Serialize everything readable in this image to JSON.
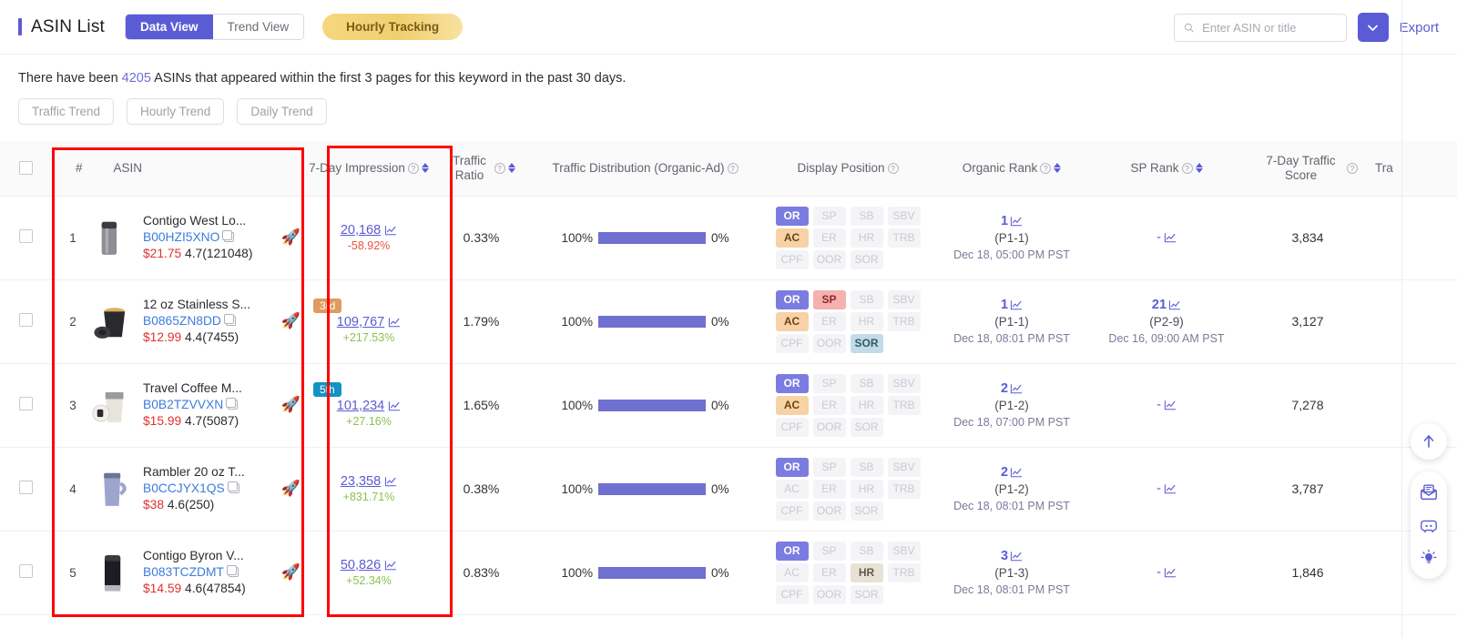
{
  "header": {
    "title": "ASIN List",
    "views": [
      {
        "label": "Data View",
        "active": true
      },
      {
        "label": "Trend View",
        "active": false
      }
    ],
    "hourly_tracking_label": "Hourly Tracking",
    "search": {
      "placeholder": "Enter ASIN or title",
      "value": ""
    },
    "dropdown_icon": "chevron-down-icon",
    "export_label": "Export"
  },
  "info": {
    "prefix": "There have been ",
    "count": "4205",
    "suffix": " ASINs that appeared within the first 3 pages for this keyword in the past 30 days."
  },
  "trend_buttons": [
    {
      "label": "Traffic Trend"
    },
    {
      "label": "Hourly Trend"
    },
    {
      "label": "Daily Trend"
    }
  ],
  "table": {
    "columns": [
      {
        "key": "checkbox",
        "label": ""
      },
      {
        "key": "asin",
        "label": "ASIN",
        "num_label": "#"
      },
      {
        "key": "impression",
        "label": "7-Day Impression",
        "help": true,
        "sortable": true
      },
      {
        "key": "traffic_ratio",
        "label": "Traffic Ratio",
        "help": true,
        "sortable": true
      },
      {
        "key": "traffic_distribution",
        "label": "Traffic Distribution (Organic-Ad)",
        "help": true,
        "sortable": false
      },
      {
        "key": "display_position",
        "label": "Display Position",
        "help": true,
        "sortable": false
      },
      {
        "key": "organic_rank",
        "label": "Organic Rank",
        "help": true,
        "sortable": true
      },
      {
        "key": "sp_rank",
        "label": "SP Rank",
        "help": true,
        "sortable": true
      },
      {
        "key": "traffic_score",
        "label": "7-Day Traffic Score",
        "help": true,
        "sortable": false
      },
      {
        "key": "truncated",
        "label": "Tra"
      }
    ],
    "position_labels": [
      "OR",
      "SP",
      "SB",
      "SBV",
      "AC",
      "ER",
      "HR",
      "TRB",
      "CPF",
      "OOR",
      "SOR"
    ],
    "rows": [
      {
        "num": "1",
        "title": "Contigo West Lo...",
        "asin": "B00HZI5XNO",
        "price": "$21.75",
        "rating": "4.7(121048)",
        "badge": null,
        "badge_color": null,
        "impression": "20,168",
        "delta": "-58.92%",
        "delta_dir": "down",
        "traffic_ratio": "0.33%",
        "dist_organic": "100%",
        "dist_ad": "0%",
        "positions_on": [
          "OR",
          "AC"
        ],
        "organic_rank": "1",
        "organic_page": "(P1-1)",
        "organic_date": "Dec 18, 05:00 PM PST",
        "sp_rank": "-",
        "sp_page": "",
        "sp_date": "",
        "traffic_score": "3,834"
      },
      {
        "num": "2",
        "title": "12 oz Stainless S...",
        "asin": "B0865ZN8DD",
        "price": "$12.99",
        "rating": "4.4(7455)",
        "badge": "3rd",
        "badge_color": "#e09a5f",
        "impression": "109,767",
        "delta": "+217.53%",
        "delta_dir": "up",
        "traffic_ratio": "1.79%",
        "dist_organic": "100%",
        "dist_ad": "0%",
        "positions_on": [
          "OR",
          "SP",
          "AC",
          "SOR"
        ],
        "organic_rank": "1",
        "organic_page": "(P1-1)",
        "organic_date": "Dec 18, 08:01 PM PST",
        "sp_rank": "21",
        "sp_page": "(P2-9)",
        "sp_date": "Dec 16, 09:00 AM PST",
        "traffic_score": "3,127"
      },
      {
        "num": "3",
        "title": "Travel Coffee M...",
        "asin": "B0B2TZVVXN",
        "price": "$15.99",
        "rating": "4.7(5087)",
        "badge": "5th",
        "badge_color": "#1392c4",
        "impression": "101,234",
        "delta": "+27.16%",
        "delta_dir": "up",
        "traffic_ratio": "1.65%",
        "dist_organic": "100%",
        "dist_ad": "0%",
        "positions_on": [
          "OR",
          "AC"
        ],
        "organic_rank": "2",
        "organic_page": "(P1-2)",
        "organic_date": "Dec 18, 07:00 PM PST",
        "sp_rank": "-",
        "sp_page": "",
        "sp_date": "",
        "traffic_score": "7,278"
      },
      {
        "num": "4",
        "title": "Rambler 20 oz T...",
        "asin": "B0CCJYX1QS",
        "price": "$38",
        "rating": "4.6(250)",
        "badge": null,
        "badge_color": null,
        "impression": "23,358",
        "delta": "+831.71%",
        "delta_dir": "up",
        "traffic_ratio": "0.38%",
        "dist_organic": "100%",
        "dist_ad": "0%",
        "positions_on": [
          "OR"
        ],
        "organic_rank": "2",
        "organic_page": "(P1-2)",
        "organic_date": "Dec 18, 08:01 PM PST",
        "sp_rank": "-",
        "sp_page": "",
        "sp_date": "",
        "traffic_score": "3,787"
      },
      {
        "num": "5",
        "title": "Contigo Byron V...",
        "asin": "B083TCZDMT",
        "price": "$14.59",
        "rating": "4.6(47854)",
        "badge": null,
        "badge_color": null,
        "impression": "50,826",
        "delta": "+52.34%",
        "delta_dir": "up",
        "traffic_ratio": "0.83%",
        "dist_organic": "100%",
        "dist_ad": "0%",
        "positions_on": [
          "OR",
          "HR"
        ],
        "organic_rank": "3",
        "organic_page": "(P1-3)",
        "organic_date": "Dec 18, 08:01 PM PST",
        "sp_rank": "-",
        "sp_page": "",
        "sp_date": "",
        "traffic_score": "1,846"
      }
    ]
  },
  "float_widgets": [
    {
      "icon": "arrow-up-icon"
    },
    {
      "icon": "mail-icon"
    },
    {
      "icon": "discord-icon"
    },
    {
      "icon": "lightbulb-icon"
    }
  ],
  "colors": {
    "accent": "#5b5bd6",
    "bar": "#6f70d0",
    "up": "#8cc152",
    "down": "#e8553e",
    "price": "#e03131",
    "annotation": "#ff0000"
  }
}
